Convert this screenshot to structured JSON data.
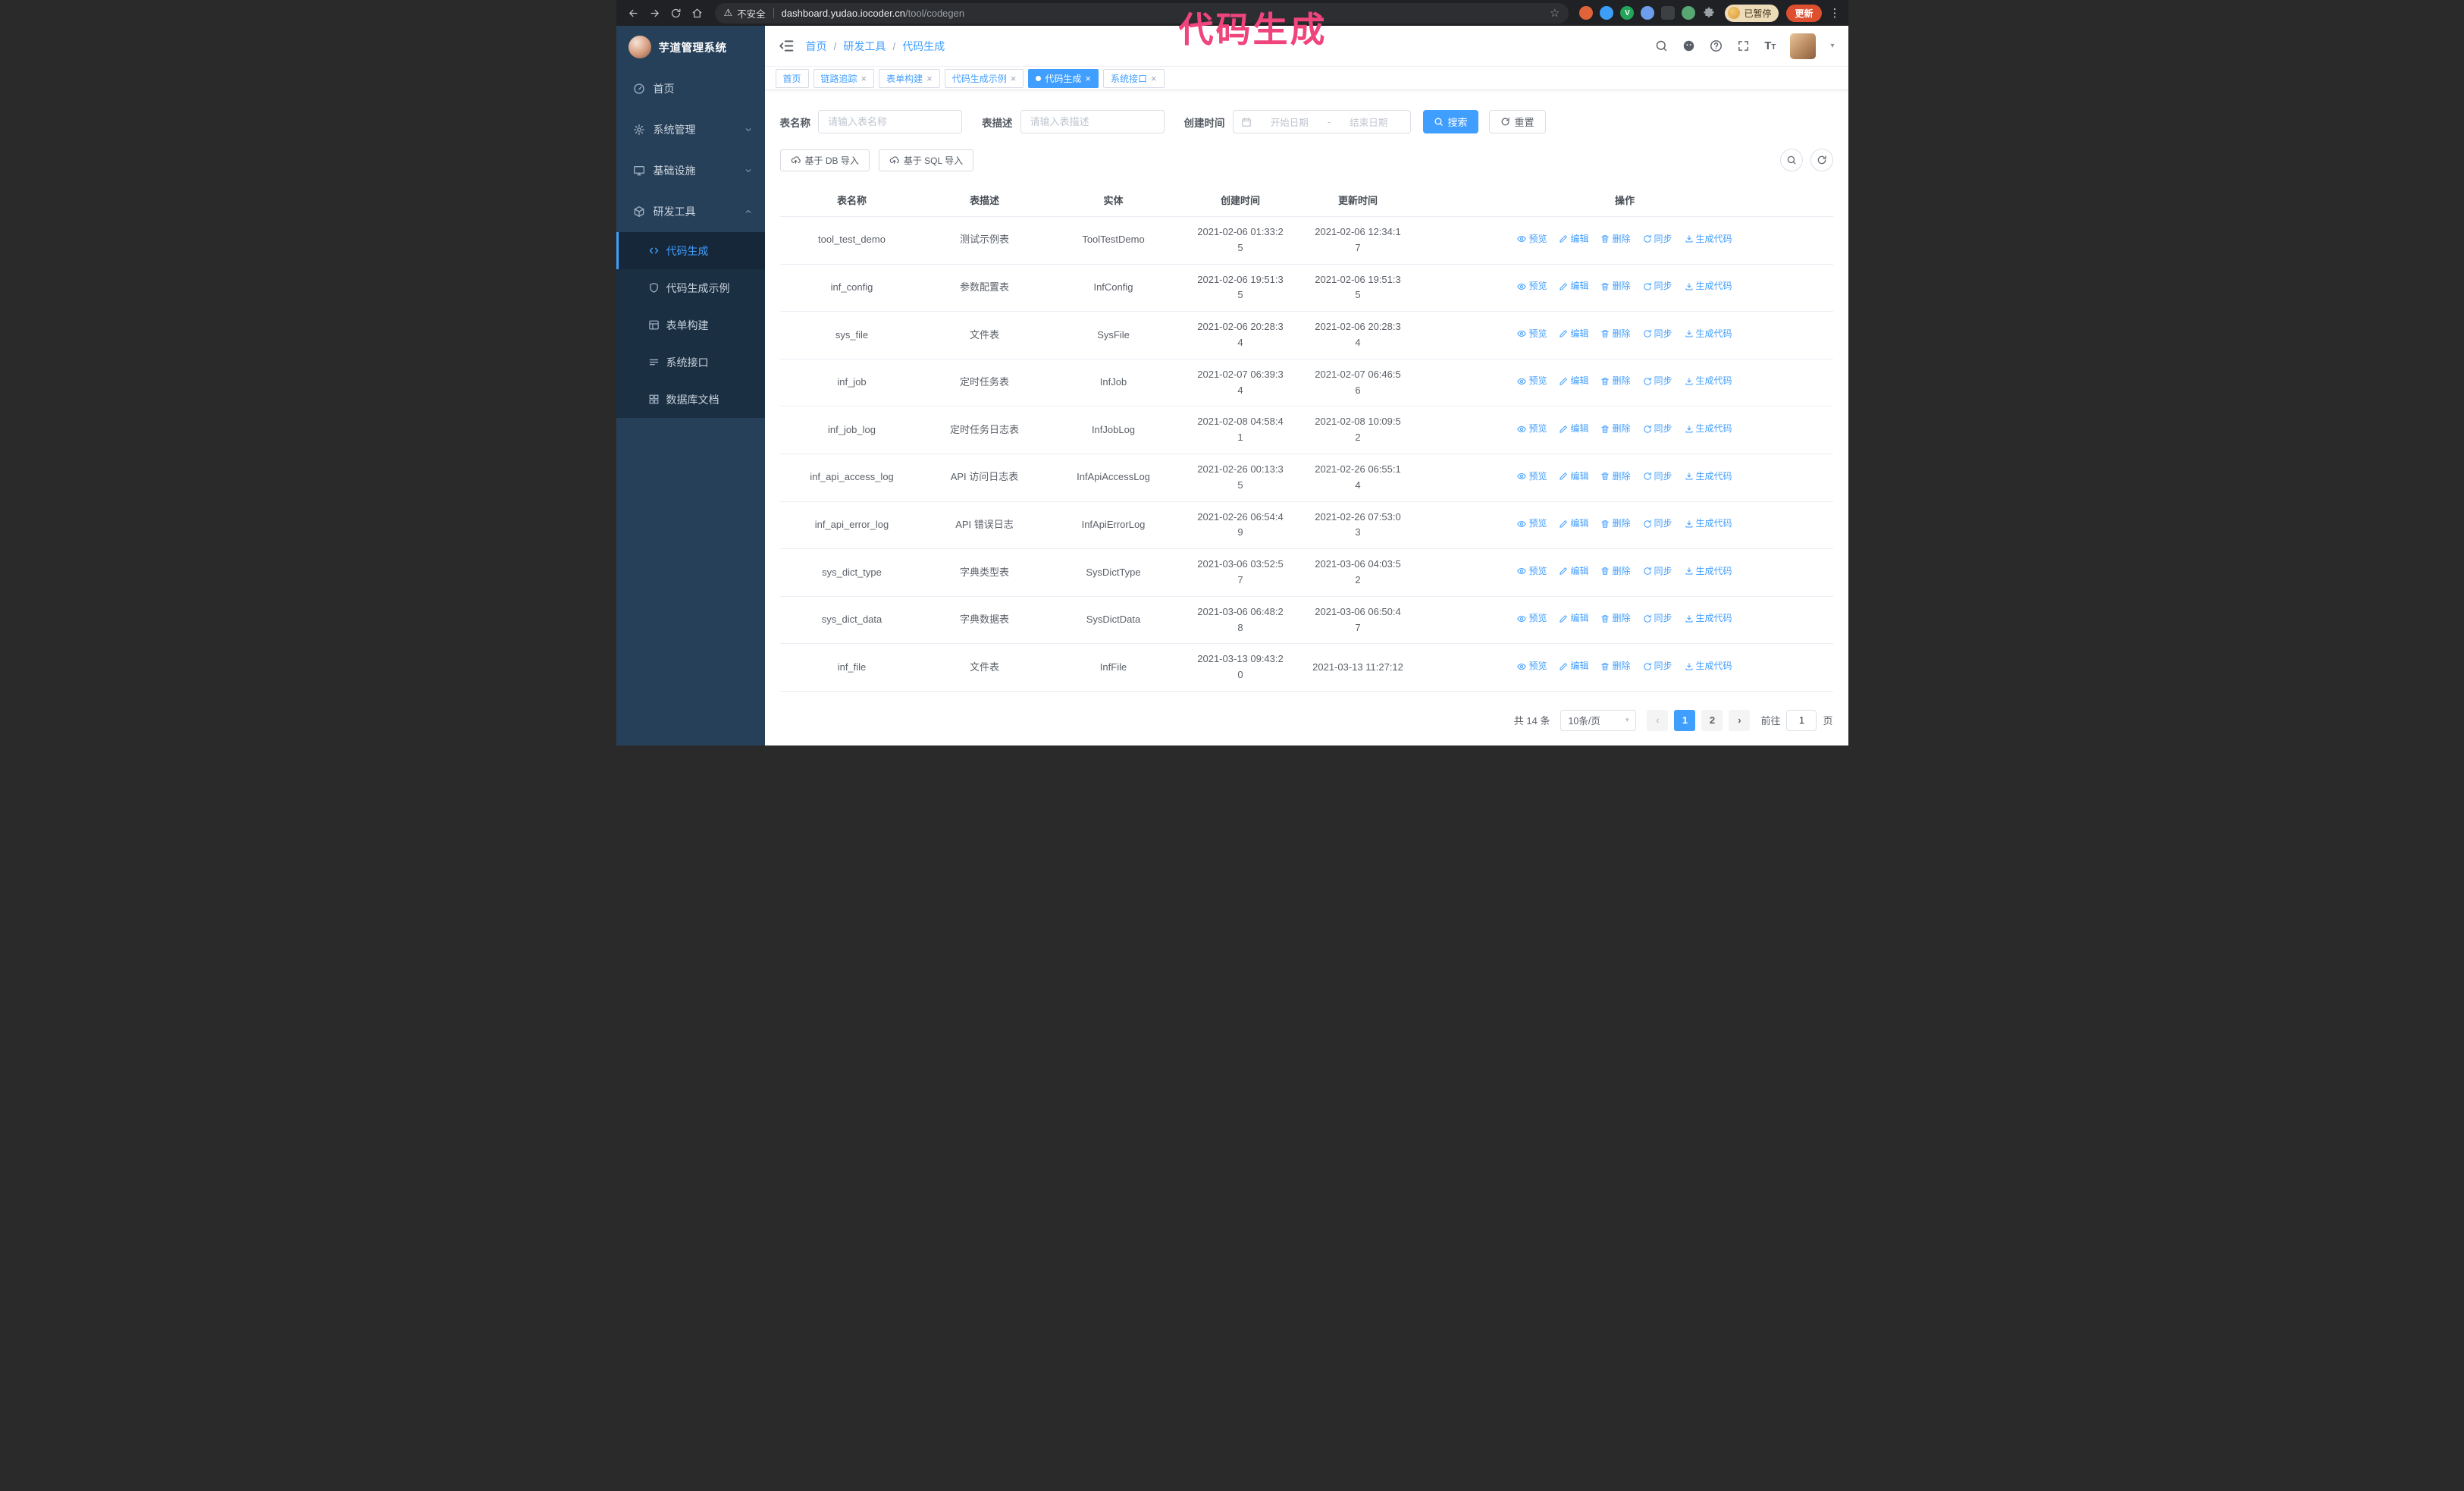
{
  "colors": {
    "accent": "#409eff",
    "annotation_pink": "#f0447c",
    "sidebar_bg": "#274059",
    "sidebar_submenu_bg": "#1b2f43",
    "update_button_bg": "#dd4f2e",
    "browser_chrome_bg": "#202124"
  },
  "glyphs": {
    "close": "×",
    "caret_down": "▾",
    "star": "☆",
    "warning": "⚠",
    "kebab": "⋮",
    "prev": "‹",
    "next": "›",
    "date_separator": "-"
  },
  "browser": {
    "security_warning": "不安全",
    "url_host": "dashboard.yudao.iocoder.cn",
    "url_path": "/tool/codegen",
    "paused_badge": "已暂停",
    "update_button": "更新"
  },
  "annotation": {
    "text": "代码生成"
  },
  "sidebar": {
    "logo_title": "芋道管理系统",
    "items": [
      {
        "label": "首页",
        "icon": "dashboard-icon"
      },
      {
        "label": "系统管理",
        "icon": "gear-icon",
        "chevron": "down"
      },
      {
        "label": "基础设施",
        "icon": "monitor-icon",
        "chevron": "down"
      },
      {
        "label": "研发工具",
        "icon": "toolbox-icon",
        "chevron": "up",
        "expanded": true
      }
    ],
    "submenu": [
      {
        "label": "代码生成",
        "icon": "code-icon",
        "active": true
      },
      {
        "label": "代码生成示例",
        "icon": "shield-icon"
      },
      {
        "label": "表单构建",
        "icon": "form-icon"
      },
      {
        "label": "系统接口",
        "icon": "api-list-icon"
      },
      {
        "label": "数据库文档",
        "icon": "grid-icon"
      }
    ]
  },
  "breadcrumb": {
    "items": [
      "首页",
      "研发工具",
      "代码生成"
    ]
  },
  "tabs": [
    {
      "label": "首页",
      "closable": false,
      "active": false
    },
    {
      "label": "链路追踪",
      "closable": true,
      "active": false
    },
    {
      "label": "表单构建",
      "closable": true,
      "active": false
    },
    {
      "label": "代码生成示例",
      "closable": true,
      "active": false
    },
    {
      "label": "代码生成",
      "closable": true,
      "active": true
    },
    {
      "label": "系统接口",
      "closable": true,
      "active": false
    }
  ],
  "filters": {
    "table_name_label": "表名称",
    "table_name_placeholder": "请输入表名称",
    "table_desc_label": "表描述",
    "table_desc_placeholder": "请输入表描述",
    "create_time_label": "创建时间",
    "date_start_placeholder": "开始日期",
    "date_end_placeholder": "结束日期",
    "search_button": "搜索",
    "reset_button": "重置"
  },
  "toolbar": {
    "import_db_button": "基于 DB 导入",
    "import_sql_button": "基于 SQL 导入"
  },
  "table": {
    "columns": [
      "表名称",
      "表描述",
      "实体",
      "创建时间",
      "更新时间",
      "操作"
    ],
    "actions": [
      "预览",
      "编辑",
      "删除",
      "同步",
      "生成代码"
    ],
    "rows": [
      {
        "name": "tool_test_demo",
        "desc": "测试示例表",
        "entity": "ToolTestDemo",
        "created": "2021-02-06 01:33:25",
        "updated": "2021-02-06 12:34:17"
      },
      {
        "name": "inf_config",
        "desc": "参数配置表",
        "entity": "InfConfig",
        "created": "2021-02-06 19:51:35",
        "updated": "2021-02-06 19:51:35"
      },
      {
        "name": "sys_file",
        "desc": "文件表",
        "entity": "SysFile",
        "created": "2021-02-06 20:28:34",
        "updated": "2021-02-06 20:28:34"
      },
      {
        "name": "inf_job",
        "desc": "定时任务表",
        "entity": "InfJob",
        "created": "2021-02-07 06:39:34",
        "updated": "2021-02-07 06:46:56"
      },
      {
        "name": "inf_job_log",
        "desc": "定时任务日志表",
        "entity": "InfJobLog",
        "created": "2021-02-08 04:58:41",
        "updated": "2021-02-08 10:09:52"
      },
      {
        "name": "inf_api_access_log",
        "desc": "API 访问日志表",
        "entity": "InfApiAccessLog",
        "created": "2021-02-26 00:13:35",
        "updated": "2021-02-26 06:55:14"
      },
      {
        "name": "inf_api_error_log",
        "desc": "API 错误日志",
        "entity": "InfApiErrorLog",
        "created": "2021-02-26 06:54:49",
        "updated": "2021-02-26 07:53:03"
      },
      {
        "name": "sys_dict_type",
        "desc": "字典类型表",
        "entity": "SysDictType",
        "created": "2021-03-06 03:52:57",
        "updated": "2021-03-06 04:03:52"
      },
      {
        "name": "sys_dict_data",
        "desc": "字典数据表",
        "entity": "SysDictData",
        "created": "2021-03-06 06:48:28",
        "updated": "2021-03-06 06:50:47"
      },
      {
        "name": "inf_file",
        "desc": "文件表",
        "entity": "InfFile",
        "created": "2021-03-13 09:43:20",
        "updated": "2021-03-13 11:27:12"
      }
    ]
  },
  "pagination": {
    "total_text": "共 14 条",
    "page_size_value": "10条/页",
    "pages": [
      "1",
      "2"
    ],
    "current_page": "1",
    "goto_label": "前往",
    "goto_value": "1",
    "goto_unit": "页"
  }
}
